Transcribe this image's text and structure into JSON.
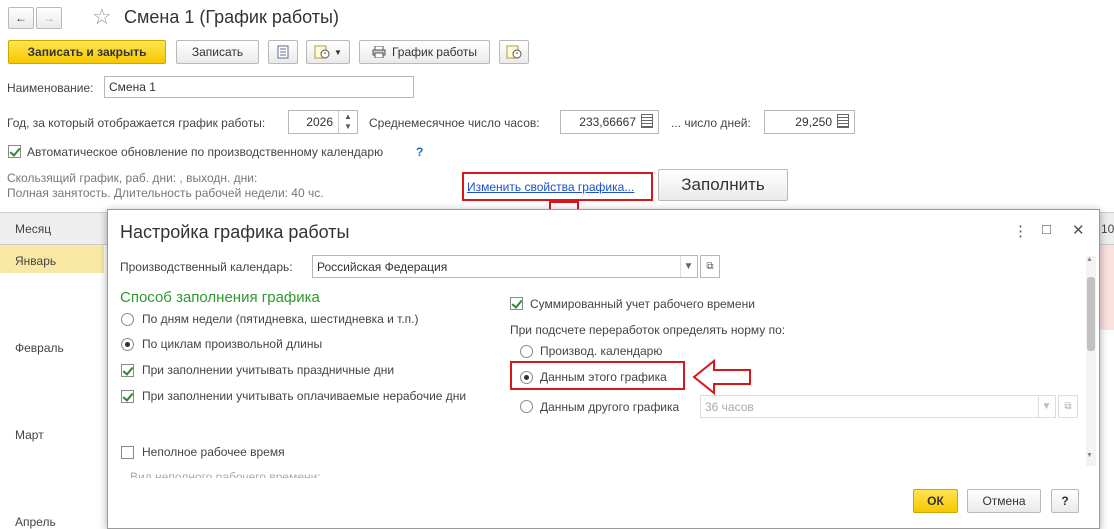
{
  "window": {
    "title": "Смена 1 (График работы)",
    "nav_back": "←",
    "nav_forward": "→",
    "star": "☆"
  },
  "toolbar": {
    "save_close": "Записать и закрыть",
    "save": "Записать",
    "schedule": "График работы"
  },
  "form": {
    "name_label": "Наименование:",
    "name_value": "Смена 1",
    "year_label": "Год, за который отображается график работы:",
    "year_value": "2026",
    "avg_hours_label": "Среднемесячное число часов:",
    "avg_hours_value": "233,66667",
    "days_label": "... число дней:",
    "days_value": "29,250",
    "auto_update_label": "Автоматическое обновление по производственному календарю",
    "help": "?",
    "info_line1": "Скользящий график, раб. дни: , выходн. дни:",
    "info_line2": "Полная занятость. Длительность рабочей недели: 40 чс.",
    "change_link": "Изменить свойства графика...",
    "fill_button": "Заполнить"
  },
  "table": {
    "month_header": "Месяц",
    "months": [
      "Январь",
      "Февраль",
      "Март",
      "Апрель"
    ],
    "right_header_fragment": "10"
  },
  "dialog": {
    "title": "Настройка графика работы",
    "menu_icon": "⋮",
    "maximize_icon": "□",
    "close_icon": "✕",
    "calendar_label": "Производственный календарь:",
    "calendar_value": "Российская Федерация",
    "fill_method_heading": "Способ заполнения графика",
    "option_weekdays": "По дням недели (пятидневка, шестидневка и т.п.)",
    "option_cycles": "По циклам произвольной длины",
    "consider_holidays": "При заполнении учитывать праздничные дни",
    "consider_paid_nonworking": "При заполнении учитывать оплачиваемые нерабочие дни",
    "part_time": "Неполное рабочее время",
    "part_time_kind": "Вид неполного рабочего времени:",
    "summarized_accounting": "Суммированный учет рабочего времени",
    "overtime_norm_label": "При подсчете переработок определять норму по:",
    "norm_calendar": "Производ. календарю",
    "norm_this_schedule": "Данным этого графика",
    "norm_other_schedule": "Данным другого графика",
    "other_schedule_value": "36 часов",
    "ok": "ОК",
    "cancel": "Отмена",
    "help": "?"
  }
}
